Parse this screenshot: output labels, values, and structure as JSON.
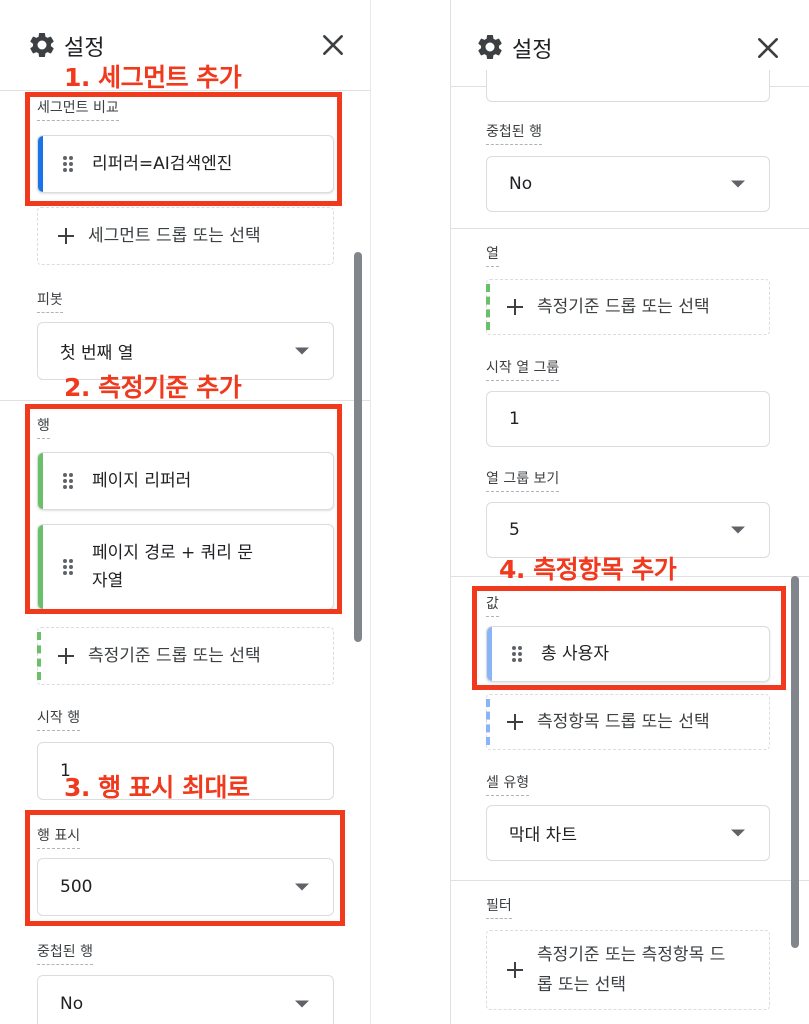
{
  "colors": {
    "accent_red": "#f0391d",
    "segment_blue": "#1a73e8",
    "dimension_green": "#6abf69",
    "metric_blue": "#8ab4f8"
  },
  "left": {
    "title": "설정",
    "annotations": [
      "1. 세그먼트 추가",
      "2. 측정기준 추가",
      "3. 행 표시 최대로"
    ],
    "segment_compare": {
      "label": "세그먼트 비교",
      "chip": "리퍼러=AI검색엔진",
      "dropzone": "세그먼트 드롭 또는 선택"
    },
    "pivot": {
      "label": "피봇",
      "value": "첫 번째 열"
    },
    "rows": {
      "label": "행",
      "chips": [
        "페이지 리퍼러",
        "페이지 경로 + 쿼리 문\n자열"
      ],
      "dropzone": "측정기준 드롭 또는 선택"
    },
    "start_row": {
      "label": "시작 행",
      "value": "1"
    },
    "show_rows": {
      "label": "행 표시",
      "value": "500"
    },
    "nested_rows": {
      "label": "중첩된 행",
      "value": "No"
    }
  },
  "right": {
    "title": "설정",
    "annotation": "4. 측정항목 추가",
    "nested_rows": {
      "label": "중첩된 행",
      "value": "No"
    },
    "columns": {
      "label": "열",
      "dropzone": "측정기준 드롭 또는 선택"
    },
    "start_col_group": {
      "label": "시작 열 그룹",
      "value": "1"
    },
    "show_col_groups": {
      "label": "열 그룹 보기",
      "value": "5"
    },
    "values": {
      "label": "값",
      "chip": "총 사용자",
      "dropzone": "측정항목 드롭 또는 선택"
    },
    "cell_type": {
      "label": "셀 유형",
      "value": "막대 차트"
    },
    "filter": {
      "label": "필터",
      "dropzone": "측정기준 또는 측정항목 드\n롭 또는 선택"
    }
  }
}
